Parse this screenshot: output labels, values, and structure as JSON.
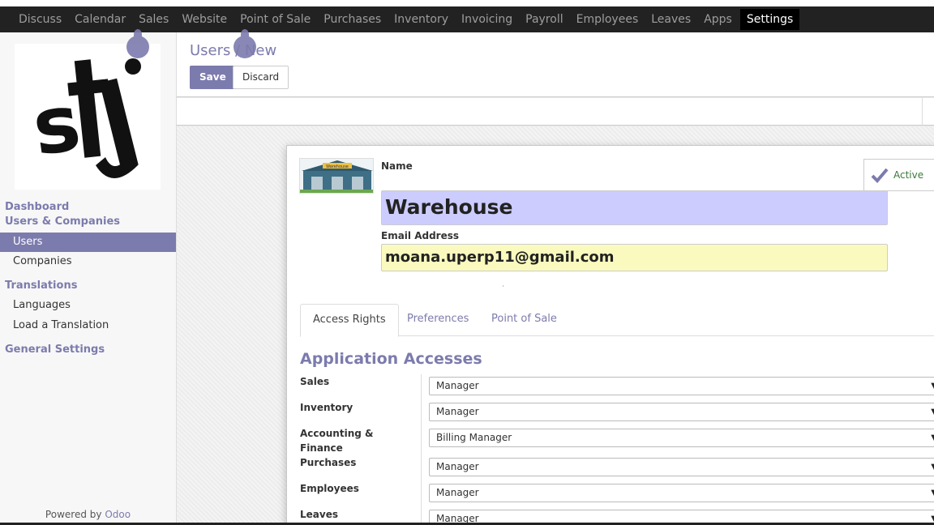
{
  "nav": {
    "items": [
      "Discuss",
      "Calendar",
      "Sales",
      "Website",
      "Point of Sale",
      "Purchases",
      "Inventory",
      "Invoicing",
      "Payroll",
      "Employees",
      "Leaves",
      "Apps",
      "Settings"
    ],
    "active": "Settings"
  },
  "sidebar": {
    "dashboard": "Dashboard",
    "users_companies": "Users & Companies",
    "users": "Users",
    "companies": "Companies",
    "translations": "Translations",
    "languages": "Languages",
    "load_translation": "Load a Translation",
    "general_settings": "General Settings",
    "powered_by": "Powered by",
    "powered_brand": "Odoo",
    "logo_text": "stj"
  },
  "header": {
    "breadcrumb": "Users / New",
    "save_label": "Save",
    "discard_label": "Discard"
  },
  "form": {
    "avatar_caption": "Warehouse",
    "name_label": "Name",
    "name_value": "Warehouse",
    "email_label": "Email Address",
    "email_value": "moana.uperp11@gmail.com",
    "active_label": "Active"
  },
  "tabs": [
    "Access Rights",
    "Preferences",
    "Point of Sale"
  ],
  "section_title": "Application Accesses",
  "accesses": [
    {
      "label": "Sales",
      "value": "Manager"
    },
    {
      "label": "Inventory",
      "value": "Manager"
    },
    {
      "label": "Accounting & Finance",
      "value": "Billing Manager"
    },
    {
      "label": "Purchases",
      "value": "Manager"
    },
    {
      "label": "Employees",
      "value": "Manager"
    },
    {
      "label": "Leaves",
      "value": "Manager"
    }
  ],
  "colors": {
    "brand": "#7c7bad",
    "navbar": "#222222",
    "name_highlight": "#ccccff",
    "email_highlight": "#fafabf"
  }
}
